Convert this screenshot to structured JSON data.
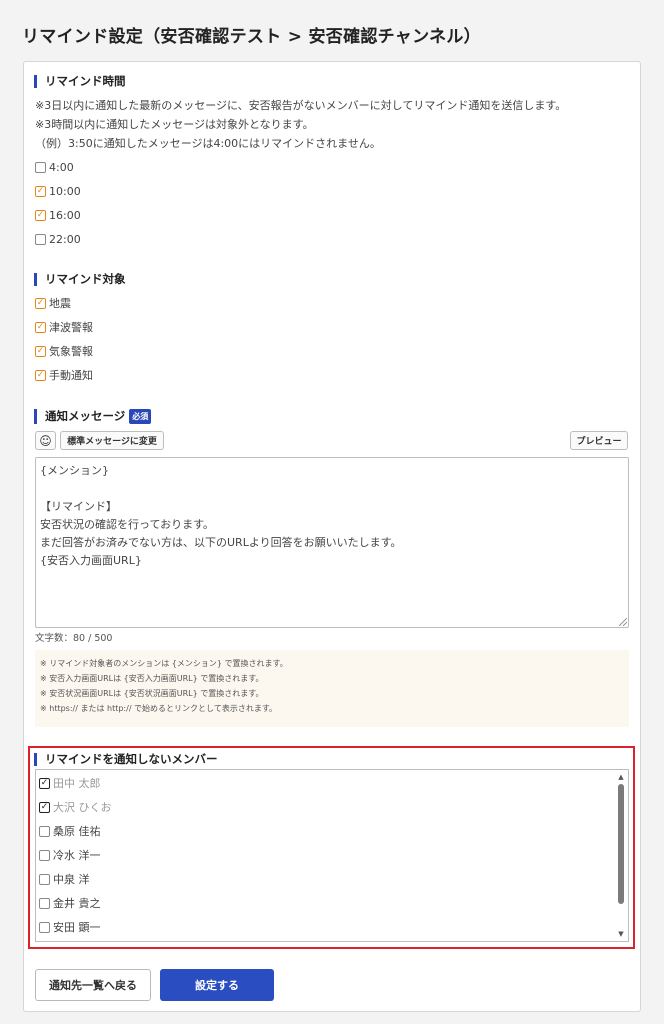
{
  "page_title": "リマインド設定（安否確認テスト > 安否確認チャンネル）",
  "remind_time": {
    "heading": "リマインド時間",
    "notes": [
      "※3日以内に通知した最新のメッセージに、安否報告がないメンバーに対してリマインド通知を送信します。",
      "※3時間以内に通知したメッセージは対象外となります。",
      "（例）3:50に通知したメッセージは4:00にはリマインドされません。"
    ],
    "options": [
      {
        "label": "4:00",
        "checked": false
      },
      {
        "label": "10:00",
        "checked": true
      },
      {
        "label": "16:00",
        "checked": true
      },
      {
        "label": "22:00",
        "checked": false
      }
    ]
  },
  "remind_target": {
    "heading": "リマインド対象",
    "options": [
      {
        "label": "地震",
        "checked": true
      },
      {
        "label": "津波警報",
        "checked": true
      },
      {
        "label": "気象警報",
        "checked": true
      },
      {
        "label": "手動通知",
        "checked": true
      }
    ]
  },
  "message": {
    "heading": "通知メッセージ",
    "required_badge": "必須",
    "emoji_icon": "smiley-icon",
    "emoji_glyph": "☺",
    "standard_button": "標準メッセージに変更",
    "preview_button": "プレビュー",
    "body_lines": [
      "{メンション}",
      "",
      "【リマインド】",
      "安否状況の確認を行っております。",
      "まだ回答がお済みでない方は、以下のURLより回答をお願いいたします。",
      "{安否入力画面URL}"
    ],
    "counter": "文字数：80 / 500",
    "hints": [
      "※ リマインド対象者のメンションは {メンション} で置換されます。",
      "※ 安否入力画面URLは {安否入力画面URL} で置換されます。",
      "※ 安否状況画面URLは {安否状況画面URL} で置換されます。",
      "※ https:// または http:// で始めるとリンクとして表示されます。"
    ]
  },
  "exclude_members": {
    "heading": "リマインドを通知しないメンバー",
    "highlight_color": "#d9232e",
    "members": [
      {
        "name": "田中 太郎",
        "checked": true
      },
      {
        "name": "大沢 ひくお",
        "checked": true
      },
      {
        "name": "桑原 佳祐",
        "checked": false
      },
      {
        "name": "冷水 洋一",
        "checked": false
      },
      {
        "name": "中泉 洋",
        "checked": false
      },
      {
        "name": "金井 貴之",
        "checked": false
      },
      {
        "name": "安田 顕一",
        "checked": false
      }
    ]
  },
  "actions": {
    "back_label": "通知先一覧へ戻る",
    "save_label": "設定する",
    "save_color": "#2a4ec2"
  },
  "glyphs": {
    "check": "✓",
    "scroll_up": "▲",
    "scroll_down": "▼"
  }
}
